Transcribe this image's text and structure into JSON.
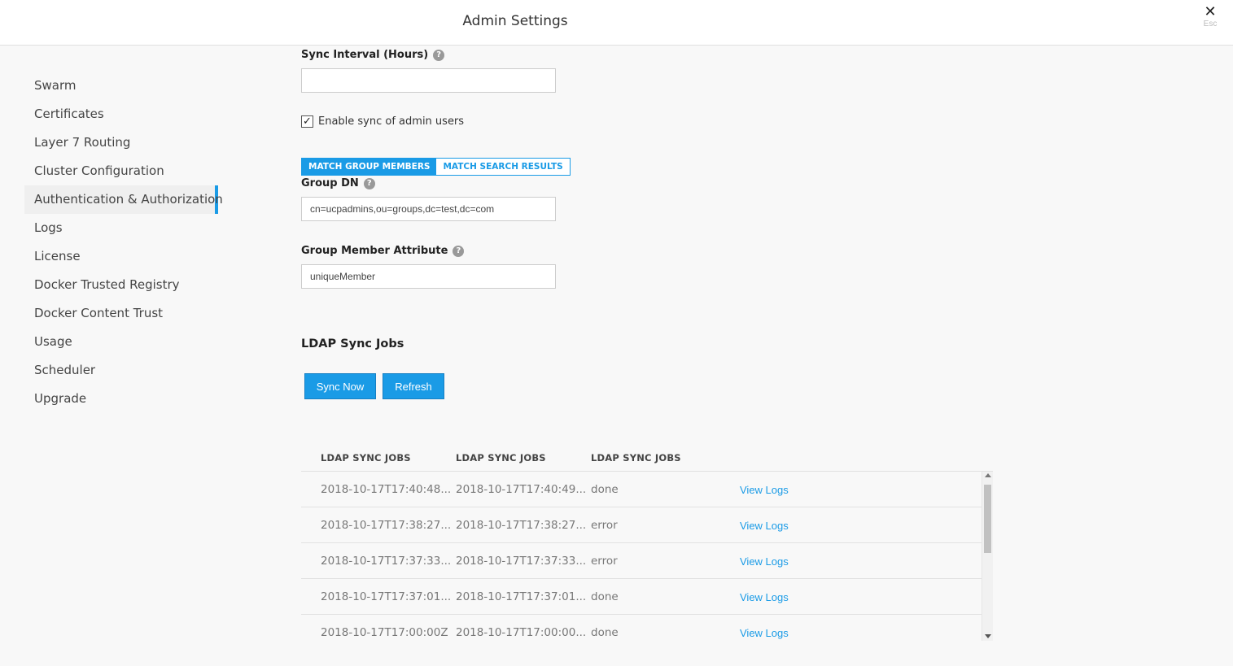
{
  "header": {
    "title": "Admin Settings",
    "close_glyph": "✕",
    "esc_label": "Esc"
  },
  "sidebar": {
    "items": [
      {
        "label": "Swarm"
      },
      {
        "label": "Certificates"
      },
      {
        "label": "Layer 7 Routing"
      },
      {
        "label": "Cluster Configuration"
      },
      {
        "label": "Authentication & Authorization",
        "active": true
      },
      {
        "label": "Logs"
      },
      {
        "label": "License"
      },
      {
        "label": "Docker Trusted Registry"
      },
      {
        "label": "Docker Content Trust"
      },
      {
        "label": "Usage"
      },
      {
        "label": "Scheduler"
      },
      {
        "label": "Upgrade"
      }
    ]
  },
  "form": {
    "sync_interval": {
      "label": "Sync Interval (Hours)",
      "value": ""
    },
    "enable_admin_sync": {
      "label": "Enable sync of admin users",
      "checked": true
    },
    "match_toggle": {
      "group_members": "MATCH GROUP MEMBERS",
      "search_results": "MATCH SEARCH RESULTS",
      "selected": "group_members"
    },
    "group_dn": {
      "label": "Group DN",
      "value": "cn=ucpadmins,ou=groups,dc=test,dc=com"
    },
    "group_member_attr": {
      "label": "Group Member Attribute",
      "value": "uniqueMember"
    }
  },
  "sync_jobs": {
    "title": "LDAP Sync Jobs",
    "sync_now_label": "Sync Now",
    "refresh_label": "Refresh",
    "columns": [
      "LDAP SYNC JOBS",
      "LDAP SYNC JOBS",
      "LDAP SYNC JOBS"
    ],
    "rows": [
      {
        "start": "2018-10-17T17:40:48...",
        "end": "2018-10-17T17:40:49...",
        "status": "done",
        "action": "View Logs"
      },
      {
        "start": "2018-10-17T17:38:27...",
        "end": "2018-10-17T17:38:27...",
        "status": "error",
        "action": "View Logs"
      },
      {
        "start": "2018-10-17T17:37:33...",
        "end": "2018-10-17T17:37:33...",
        "status": "error",
        "action": "View Logs"
      },
      {
        "start": "2018-10-17T17:37:01...",
        "end": "2018-10-17T17:37:01...",
        "status": "done",
        "action": "View Logs"
      },
      {
        "start": "2018-10-17T17:00:00Z",
        "end": "2018-10-17T17:00:00...",
        "status": "done",
        "action": "View Logs"
      }
    ]
  },
  "icons": {
    "help": "help-circle-icon",
    "close": "close-icon",
    "check": "checkmark-icon"
  },
  "colors": {
    "accent": "#1a9be6",
    "active_nav_bg": "#efefef"
  }
}
